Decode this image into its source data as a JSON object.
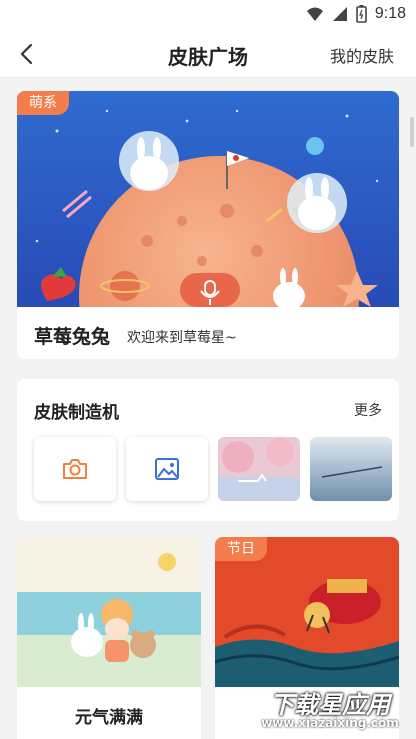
{
  "status_bar": {
    "time": "9:18"
  },
  "header": {
    "title": "皮肤广场",
    "right_link": "我的皮肤"
  },
  "featured": {
    "tag": "萌系",
    "name": "草莓兔兔",
    "description": "欢迎来到草莓星~"
  },
  "maker": {
    "title": "皮肤制造机",
    "more_label": "更多"
  },
  "themes": [
    {
      "label": "元气满满"
    },
    {
      "tag": "节日",
      "label": ""
    }
  ],
  "watermark": {
    "main": "下载星应用",
    "sub": "www.xiazaixing.com"
  },
  "colors": {
    "accent": "#f47d4d",
    "icon_orange": "#f08040",
    "icon_blue": "#3e6fd6"
  }
}
